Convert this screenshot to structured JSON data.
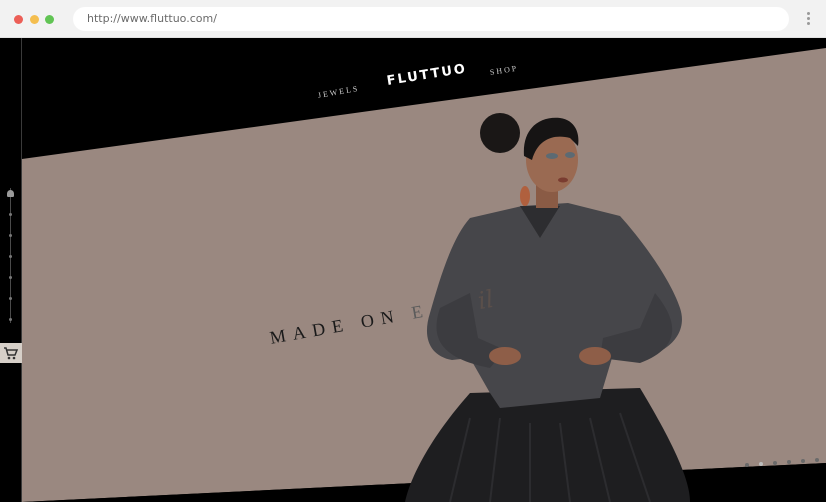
{
  "browser": {
    "url": "http://www.fluttuo.com/"
  },
  "nav": {
    "left_item": "JEWELS",
    "logo": "FLUTTUO",
    "right_item": "SHOP"
  },
  "hero": {
    "headline": "MADE ON",
    "headline_faded_letter": "E",
    "script_fragment": "il",
    "background_color": "#9a8880"
  },
  "sidebar": {
    "cart_icon": "cart-icon",
    "nav_dot_count": 6
  },
  "pagination": {
    "total": 6,
    "active_index": 1
  }
}
